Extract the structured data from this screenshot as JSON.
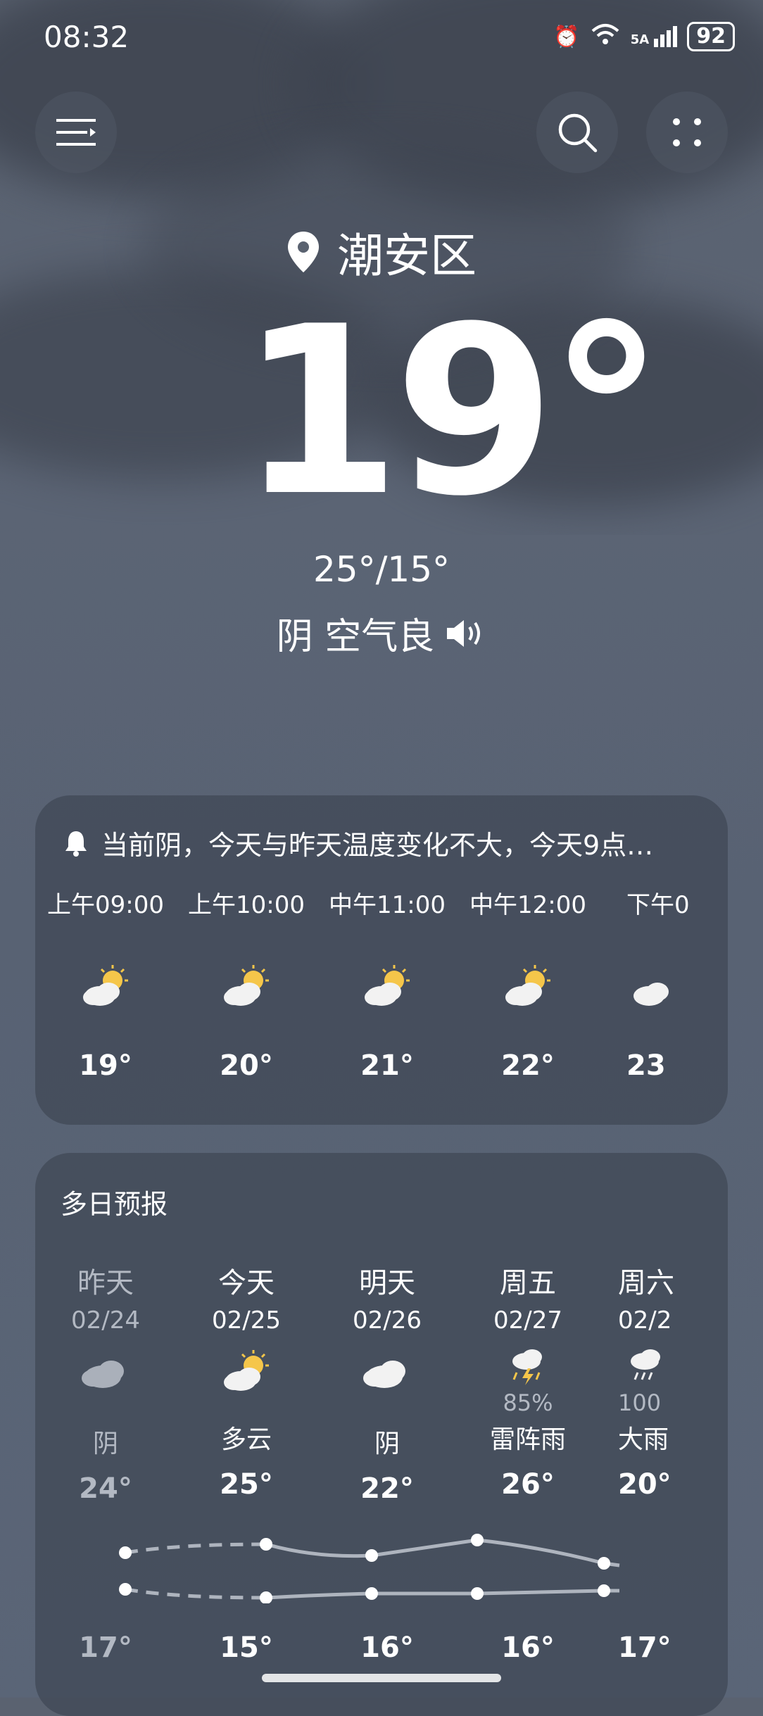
{
  "status": {
    "time": "08:32",
    "signal": "5A",
    "battery": "92"
  },
  "location": {
    "name": "潮安区"
  },
  "current": {
    "temp": "19°",
    "hilo": "25°/15°",
    "condition": "阴 空气良"
  },
  "hourly": {
    "alert": "当前阴，今天与昨天温度变化不大，今天9点…",
    "items": [
      {
        "time": "上午09:00",
        "temp": "19°",
        "icon": "partly-cloudy-icon"
      },
      {
        "time": "上午10:00",
        "temp": "20°",
        "icon": "partly-cloudy-icon"
      },
      {
        "time": "中午11:00",
        "temp": "21°",
        "icon": "partly-cloudy-icon"
      },
      {
        "time": "中午12:00",
        "temp": "22°",
        "icon": "partly-cloudy-icon"
      },
      {
        "time": "下午0",
        "temp": "23",
        "icon": "partly-cloudy-icon"
      }
    ]
  },
  "daily": {
    "title": "多日预报",
    "items": [
      {
        "day": "昨天",
        "date": "02/24",
        "cond": "阴",
        "high": "24°",
        "low": "17°",
        "precip": "",
        "icon": "cloudy-icon"
      },
      {
        "day": "今天",
        "date": "02/25",
        "cond": "多云",
        "high": "25°",
        "low": "15°",
        "precip": "",
        "icon": "partly-cloudy-icon"
      },
      {
        "day": "明天",
        "date": "02/26",
        "cond": "阴",
        "high": "22°",
        "low": "16°",
        "precip": "",
        "icon": "cloudy-icon"
      },
      {
        "day": "周五",
        "date": "02/27",
        "cond": "雷阵雨",
        "high": "26°",
        "low": "16°",
        "precip": "85%",
        "icon": "thunderstorm-icon"
      },
      {
        "day": "周六",
        "date": "02/2",
        "cond": "大雨",
        "high": "20°",
        "low": "17°",
        "precip": "100",
        "icon": "heavy-rain-icon"
      }
    ]
  }
}
